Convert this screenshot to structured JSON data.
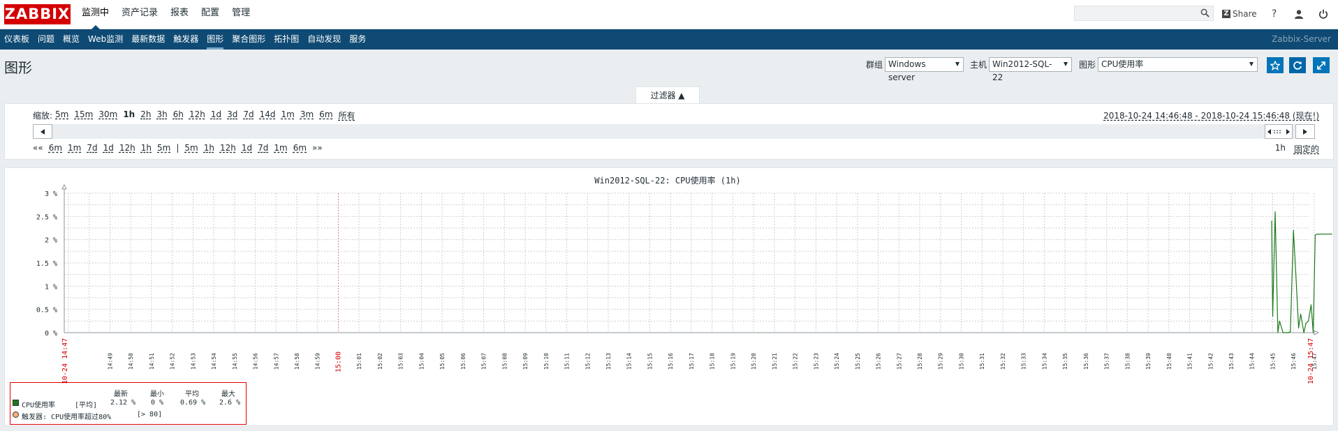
{
  "logo": "ZABBIX",
  "main_nav": [
    {
      "label": "监测中",
      "active": true
    },
    {
      "label": "资产记录",
      "active": false
    },
    {
      "label": "报表",
      "active": false
    },
    {
      "label": "配置",
      "active": false
    },
    {
      "label": "管理",
      "active": false
    }
  ],
  "search": {
    "value": "",
    "icon": "search-icon"
  },
  "top_right": {
    "share_label": "Share",
    "help": "?",
    "icons": [
      "help-icon",
      "user-icon",
      "power-icon"
    ]
  },
  "sub_nav": [
    {
      "label": "仪表板",
      "active": false
    },
    {
      "label": "问题",
      "active": false
    },
    {
      "label": "概览",
      "active": false
    },
    {
      "label": "Web监测",
      "active": false
    },
    {
      "label": "最新数据",
      "active": false
    },
    {
      "label": "触发器",
      "active": false
    },
    {
      "label": "图形",
      "active": true
    },
    {
      "label": "聚合图形",
      "active": false
    },
    {
      "label": "拓扑图",
      "active": false
    },
    {
      "label": "自动发现",
      "active": false
    },
    {
      "label": "服务",
      "active": false
    }
  ],
  "server_name": "Zabbix-Server",
  "page_title": "图形",
  "controls": {
    "group_label": "群组",
    "group_value": "Windows server",
    "host_label": "主机",
    "host_value": "Win2012-SQL-22",
    "graph_label": "图形",
    "graph_value": "CPU使用率"
  },
  "filter": {
    "tab_label": "过滤器 ▲",
    "zoom_label": "缩放:",
    "zoom_options": [
      "5m",
      "15m",
      "30m",
      "1h",
      "2h",
      "3h",
      "6h",
      "12h",
      "1d",
      "3d",
      "7d",
      "14d",
      "1m",
      "3m",
      "6m",
      "所有"
    ],
    "zoom_active": "1h",
    "range_text": "2018-10-24 14:46:48 - 2018-10-24 15:46:48 (现在!)",
    "nav_back_prefix": "««",
    "nav_back": [
      "6m",
      "1m",
      "7d",
      "1d",
      "12h",
      "1h",
      "5m"
    ],
    "nav_sep": "|",
    "nav_fwd": [
      "5m",
      "1h",
      "12h",
      "1d",
      "7d",
      "1m",
      "6m"
    ],
    "nav_fwd_suffix": "»»",
    "period": "1h",
    "fixed": "固定的"
  },
  "chart_data": {
    "type": "line",
    "title": "Win2012-SQL-22: CPU使用率 (1h)",
    "ylabel": "",
    "ylim": [
      0,
      3
    ],
    "y_ticks": [
      "0 %",
      "0.5 %",
      "1 %",
      "1.5 %",
      "2 %",
      "2.5 %",
      "3 %"
    ],
    "x_start_label": "10-24 14:47",
    "x_end_label": "10-24 15:47",
    "x_tick_labels": [
      "14:49",
      "14:50",
      "14:51",
      "14:52",
      "14:53",
      "14:54",
      "14:55",
      "14:56",
      "14:57",
      "14:58",
      "14:59",
      "15:00",
      "15:01",
      "15:02",
      "15:03",
      "15:04",
      "15:05",
      "15:06",
      "15:07",
      "15:08",
      "15:09",
      "15:10",
      "15:11",
      "15:12",
      "15:13",
      "15:14",
      "15:15",
      "15:16",
      "15:17",
      "15:18",
      "15:19",
      "15:20",
      "15:21",
      "15:22",
      "15:23",
      "15:24",
      "15:25",
      "15:26",
      "15:27",
      "15:28",
      "15:29",
      "15:30",
      "15:31",
      "15:32",
      "15:33",
      "15:34",
      "15:35",
      "15:36",
      "15:37",
      "15:38",
      "15:39",
      "15:40",
      "15:41",
      "15:42",
      "15:43",
      "15:44",
      "15:45",
      "15:46",
      "15:47"
    ],
    "highlight_tick": "15:00",
    "series": [
      {
        "name": "CPU使用率",
        "color": "#1a7a1a",
        "x_minutes": [
          44.95,
          45.0,
          45.12,
          45.25,
          45.33,
          45.5,
          45.65,
          45.75,
          45.85,
          46.0,
          46.12,
          46.25,
          46.35,
          46.5,
          46.6,
          46.72,
          46.85,
          46.95,
          47.05,
          47.15,
          47.25,
          47.33,
          47.45,
          47.55,
          47.65,
          47.75,
          47.85
        ],
        "values": [
          2.4,
          0.35,
          2.6,
          0.0,
          0.25,
          0.0,
          0.0,
          0.0,
          0.02,
          2.2,
          1.2,
          0.1,
          0.4,
          0.0,
          0.2,
          0.25,
          0.6,
          0.0,
          2.1,
          2.12,
          2.12,
          2.12,
          2.12,
          2.12,
          2.12,
          2.12,
          2.12
        ]
      }
    ],
    "legend": {
      "headers": [
        "最新",
        "最小",
        "平均",
        "最大"
      ],
      "item_name": "CPU使用率",
      "item_func": "[平均]",
      "item_values": [
        "2.12 %",
        "0 %",
        "0.69 %",
        "2.6 %"
      ],
      "trigger_text": "触发器: CPU使用率超过80%",
      "trigger_cond": "[> 80]",
      "trigger_color": "#f7b27b"
    }
  }
}
